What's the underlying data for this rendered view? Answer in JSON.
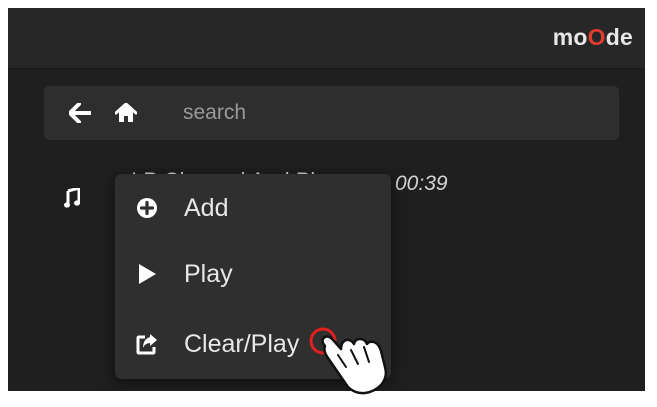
{
  "header": {
    "logo_prefix": "mo",
    "logo_accent": "O",
    "logo_suffix": "de",
    "accent_color": "#e03b2f"
  },
  "search": {
    "placeholder": "search",
    "back_icon": "arrow-left-icon",
    "home_icon": "home-icon"
  },
  "track": {
    "icon": "music-note-icon",
    "title": "I P Channel And Pl",
    "time": "00:39"
  },
  "context_menu": {
    "items": [
      {
        "label": "Add",
        "icon": "plus-circle-icon"
      },
      {
        "label": "Play",
        "icon": "play-icon"
      },
      {
        "label": "Clear/Play",
        "icon": "share-square-icon"
      }
    ]
  },
  "pointer": {
    "icon": "hand-pointer-icon"
  }
}
